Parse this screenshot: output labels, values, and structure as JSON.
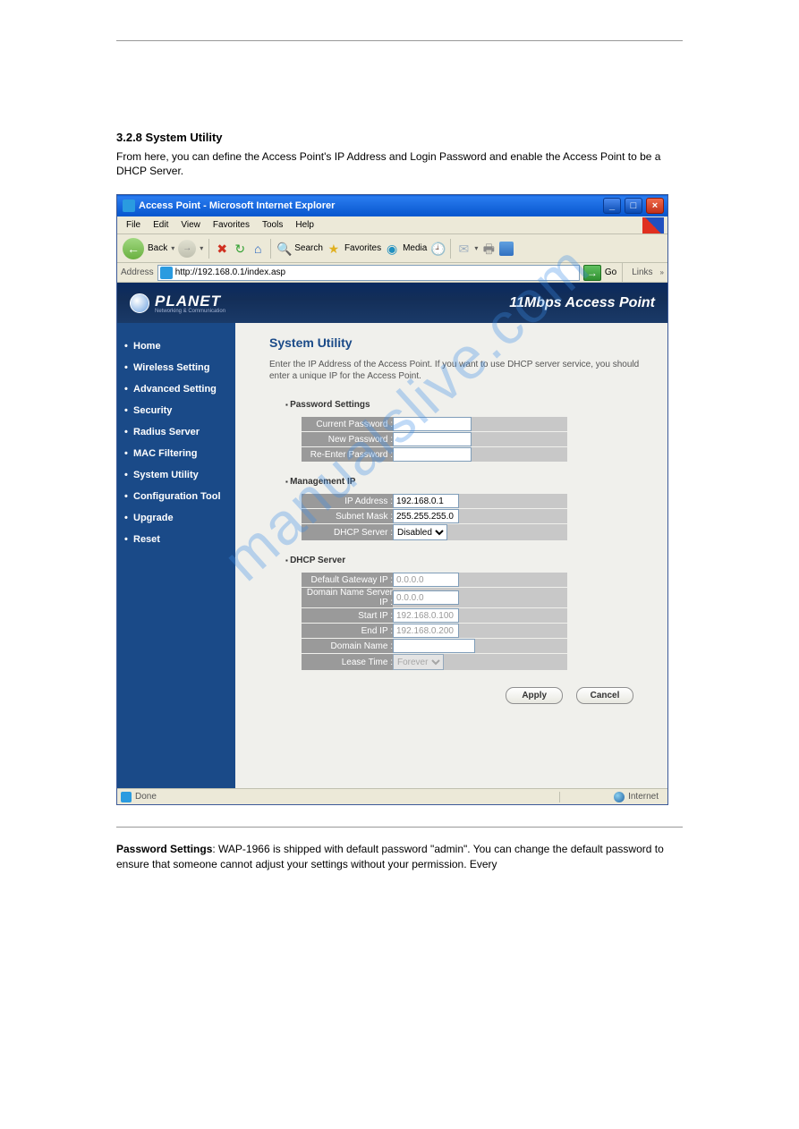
{
  "doc": {
    "heading": "3.2.8 System Utility",
    "body": "From here, you can define the Access Point's IP Address and Login Password and enable the Access Point to be a DHCP Server.",
    "password_heading": "Password Settings",
    "password_body": "WAP-1966 is shipped with default password \"admin\". You can change the default password to ensure that someone cannot adjust your settings without your permission. Every"
  },
  "ie": {
    "title": "Access Point - Microsoft Internet Explorer",
    "menus": [
      "File",
      "Edit",
      "View",
      "Favorites",
      "Tools",
      "Help"
    ],
    "back": "Back",
    "search": "Search",
    "favorites": "Favorites",
    "media": "Media",
    "addr_label": "Address",
    "url": "http://192.168.0.1/index.asp",
    "go": "Go",
    "links": "Links",
    "status": "Done",
    "zone": "Internet"
  },
  "header": {
    "brand": "PLANET",
    "sub": "Networking & Communication",
    "tagline": "11Mbps Access Point"
  },
  "nav": {
    "items": [
      "Home",
      "Wireless Setting",
      "Advanced Setting",
      "Security",
      "Radius Server",
      "MAC Filtering",
      "System Utility",
      "Configuration Tool",
      "Upgrade",
      "Reset"
    ]
  },
  "page": {
    "title": "System Utility",
    "desc": "Enter the IP Address of the Access Point. If you want to use DHCP server service, you should enter a unique IP for the Access Point."
  },
  "sections": {
    "pw": {
      "title": "Password Settings",
      "fields": {
        "current": "Current Password :",
        "new": "New Password :",
        "reenter": "Re-Enter Password :"
      }
    },
    "mgmt": {
      "title": "Management IP",
      "fields": {
        "ip": "IP Address :",
        "mask": "Subnet Mask :",
        "dhcp": "DHCP Server :"
      },
      "values": {
        "ip": "192.168.0.1",
        "mask": "255.255.255.0",
        "dhcp": "Disabled"
      }
    },
    "dhcp": {
      "title": "DHCP Server",
      "fields": {
        "gw": "Default Gateway IP :",
        "dns": "Domain Name Server IP :",
        "start": "Start IP :",
        "end": "End IP :",
        "domain": "Domain Name :",
        "lease": "Lease Time :"
      },
      "values": {
        "gw": "0.0.0.0",
        "dns": "0.0.0.0",
        "start": "192.168.0.100",
        "end": "192.168.0.200",
        "domain": "",
        "lease": "Forever"
      }
    }
  },
  "buttons": {
    "apply": "Apply",
    "cancel": "Cancel"
  },
  "watermark": "manualslive.com"
}
